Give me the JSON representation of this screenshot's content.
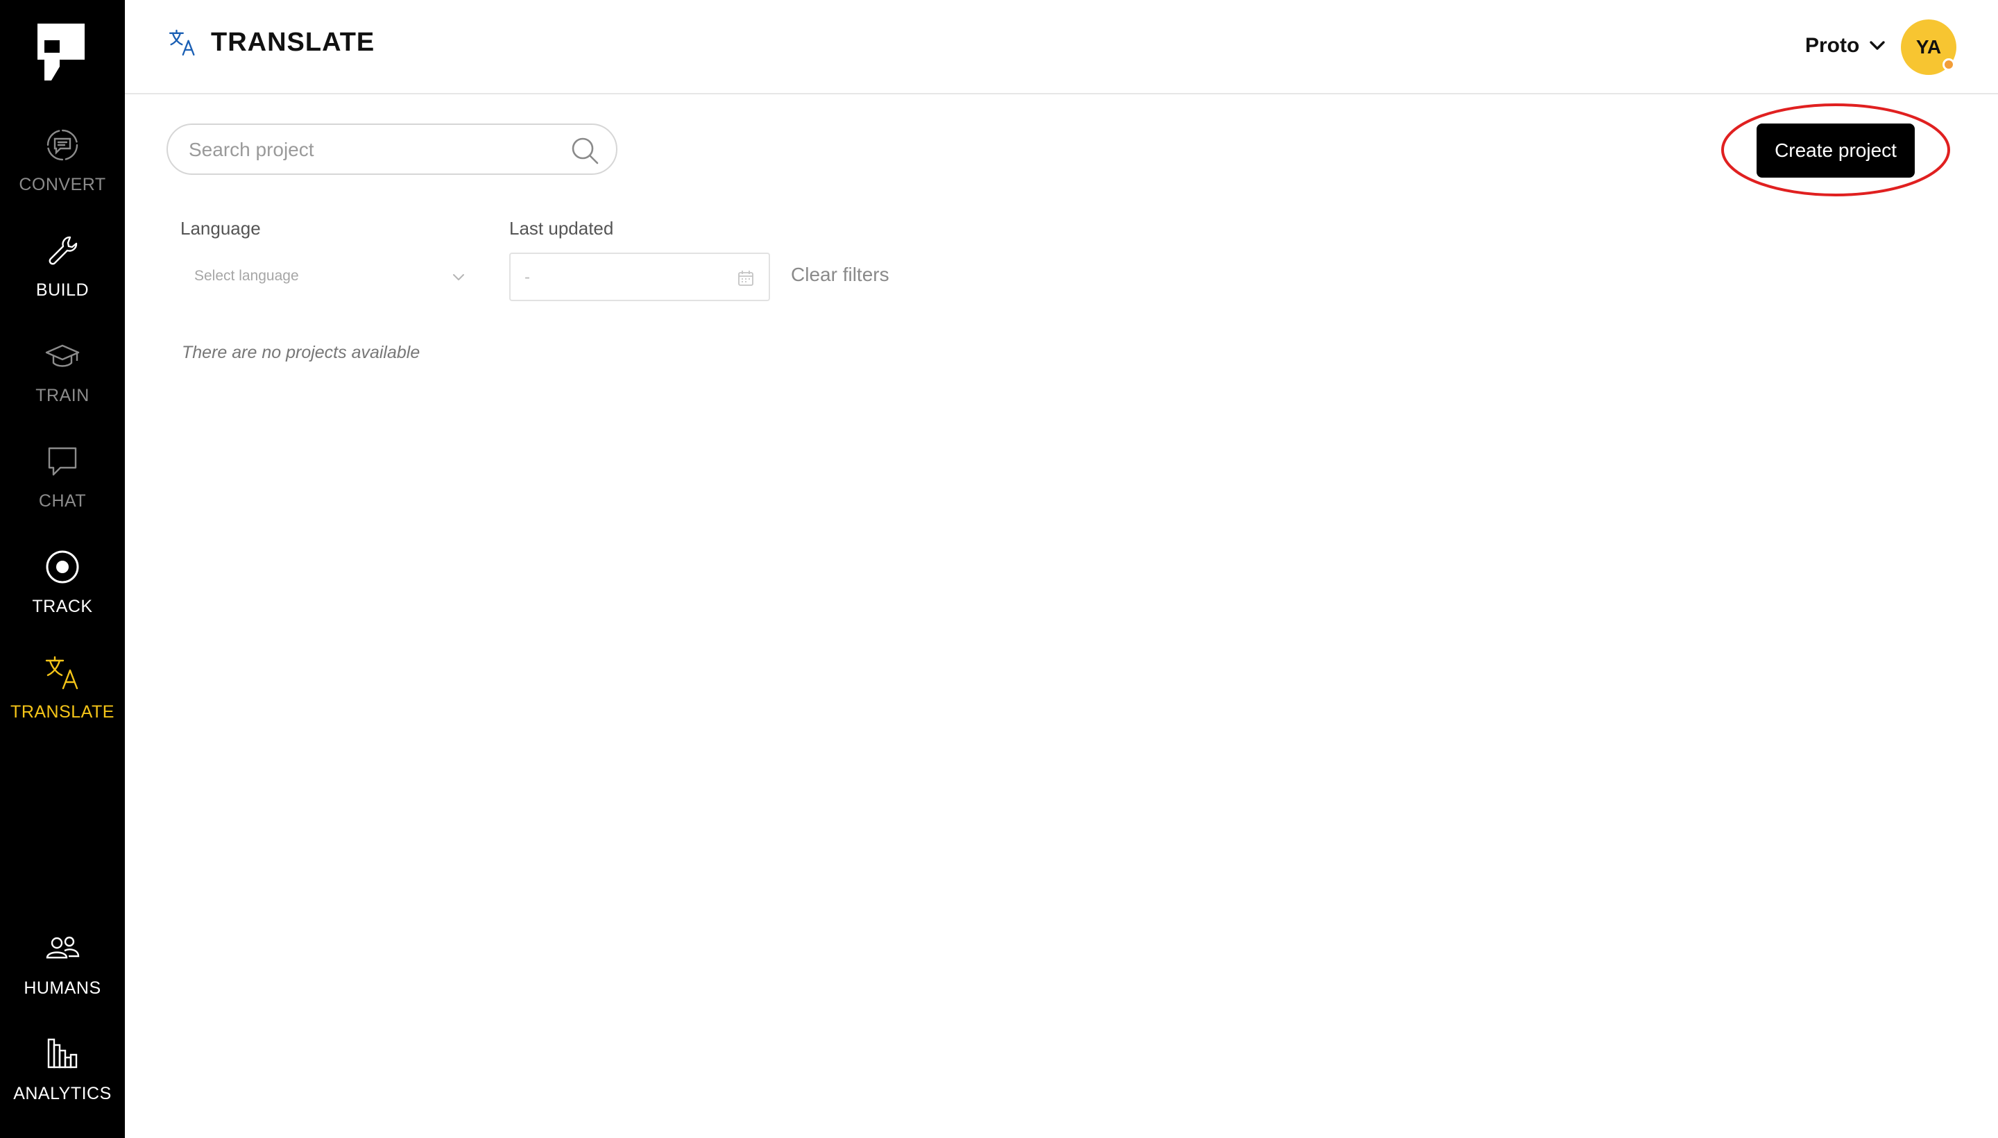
{
  "sidebar": {
    "items": [
      {
        "label": "CONVERT",
        "icon": "convert-chat-icon"
      },
      {
        "label": "BUILD",
        "icon": "wrench-icon"
      },
      {
        "label": "TRAIN",
        "icon": "graduation-cap-icon"
      },
      {
        "label": "CHAT",
        "icon": "chat-bubble-icon"
      },
      {
        "label": "TRACK",
        "icon": "target-icon"
      },
      {
        "label": "TRANSLATE",
        "icon": "translate-icon"
      },
      {
        "label": "HUMANS",
        "icon": "users-icon"
      },
      {
        "label": "ANALYTICS",
        "icon": "bar-chart-icon"
      }
    ],
    "active_item": "TRANSLATE"
  },
  "header": {
    "title": "TRANSLATE",
    "icon": "translate-icon",
    "workspace": "Proto",
    "avatar_initials": "YA"
  },
  "search": {
    "placeholder": "Search project",
    "value": ""
  },
  "actions": {
    "create_label": "Create project"
  },
  "filters": {
    "language_label": "Language",
    "language_placeholder": "Select language",
    "last_updated_label": "Last updated",
    "last_updated_value": "-",
    "clear_label": "Clear filters"
  },
  "projects": {
    "empty_message": "There are no projects available"
  },
  "colors": {
    "sidebar_bg": "#000000",
    "accent": "#f5c518",
    "avatar_bg": "#f7c531",
    "status_dot": "#f29d38",
    "header_icon": "#1a5fb4",
    "highlight_ring": "#e02020",
    "primary_button": "#000000"
  }
}
